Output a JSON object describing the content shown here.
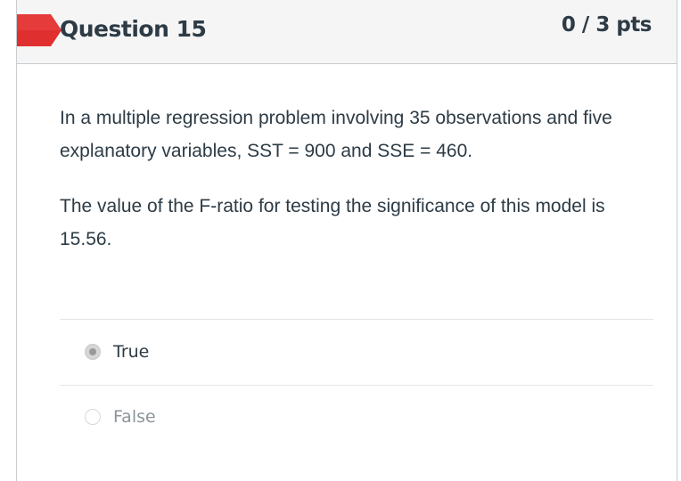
{
  "question": {
    "title": "Question 15",
    "points": "0 / 3 pts",
    "paragraphs": [
      "In a multiple regression problem involving 35 observations and five explanatory variables, SST = 900 and SSE = 460.",
      "The value of the F-ratio for testing the significance of this model is 15.56."
    ]
  },
  "answers": [
    {
      "label": "True",
      "selected": true
    },
    {
      "label": "False",
      "selected": false
    }
  ],
  "colors": {
    "flag": "#e02f2f",
    "text": "#2d3b45",
    "header_bg": "#f5f5f5",
    "border": "#c7cdd1",
    "muted_text": "#8b959b"
  },
  "icons": {
    "flag": "incorrect-flag-icon"
  }
}
